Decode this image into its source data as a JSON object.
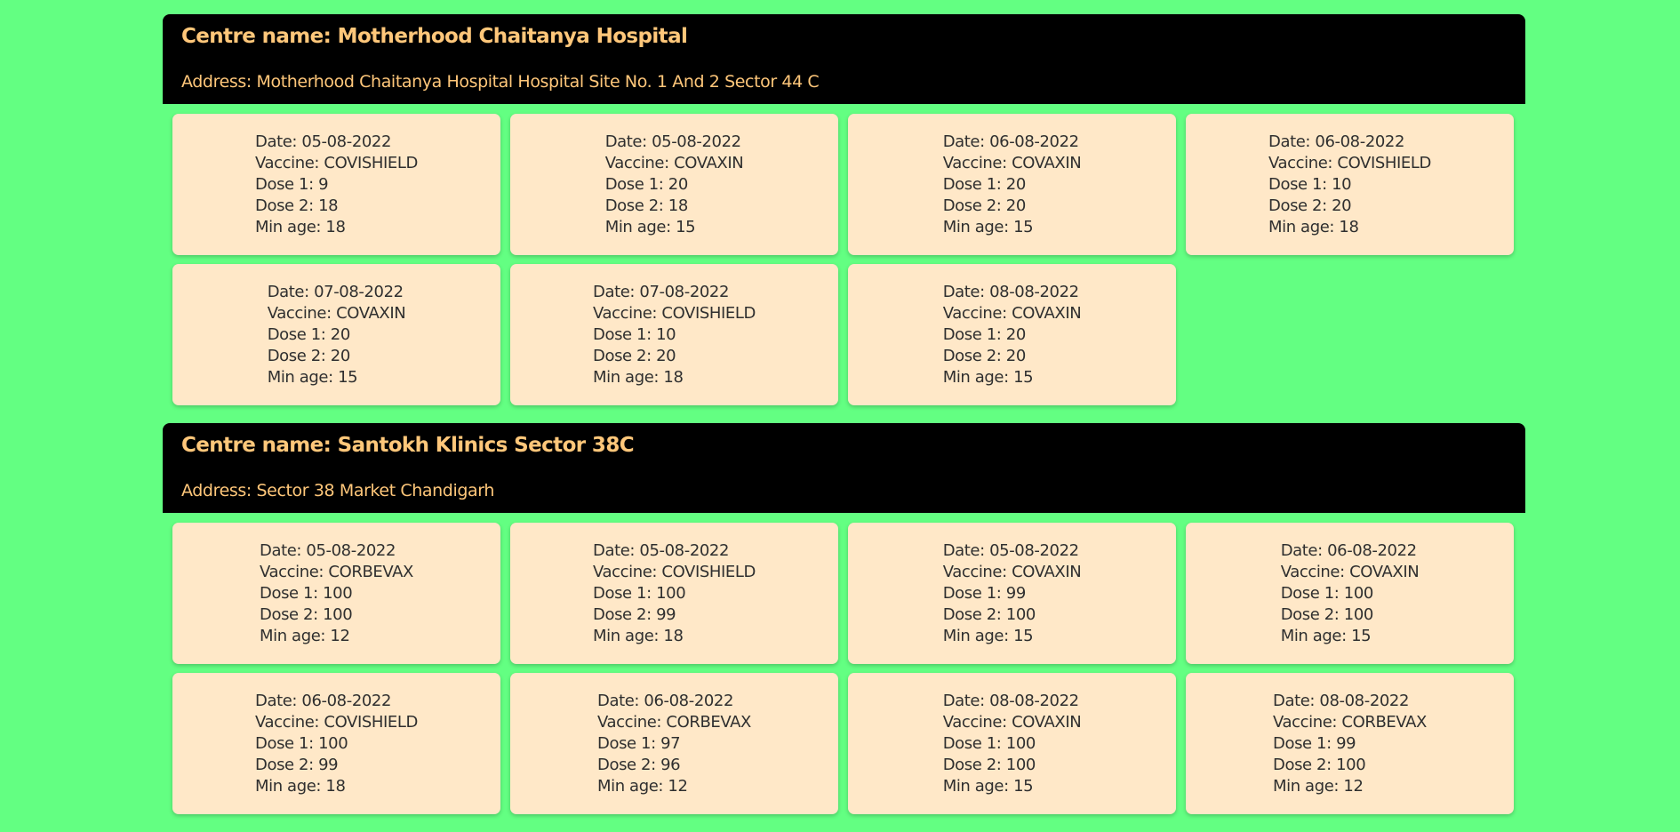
{
  "labels": {
    "centre_prefix": "Centre name: ",
    "address_prefix": "Address: ",
    "date": "Date: ",
    "vaccine": "Vaccine: ",
    "dose1": "Dose 1: ",
    "dose2": "Dose 2: ",
    "min_age": "Min age: "
  },
  "colors": {
    "page_background": "#63ff82",
    "header_background": "#000000",
    "header_text": "#ffc77a",
    "card_background": "#ffe8c8"
  },
  "centres": [
    {
      "name": "Motherhood Chaitanya Hospital",
      "address": "Motherhood Chaitanya Hospital Hospital Site No. 1 And 2 Sector 44 C",
      "sessions": [
        {
          "date": "05-08-2022",
          "vaccine": "COVISHIELD",
          "dose1": "9",
          "dose2": "18",
          "min_age": "18"
        },
        {
          "date": "05-08-2022",
          "vaccine": "COVAXIN",
          "dose1": "20",
          "dose2": "18",
          "min_age": "15"
        },
        {
          "date": "06-08-2022",
          "vaccine": "COVAXIN",
          "dose1": "20",
          "dose2": "20",
          "min_age": "15"
        },
        {
          "date": "06-08-2022",
          "vaccine": "COVISHIELD",
          "dose1": "10",
          "dose2": "20",
          "min_age": "18"
        },
        {
          "date": "07-08-2022",
          "vaccine": "COVAXIN",
          "dose1": "20",
          "dose2": "20",
          "min_age": "15"
        },
        {
          "date": "07-08-2022",
          "vaccine": "COVISHIELD",
          "dose1": "10",
          "dose2": "20",
          "min_age": "18"
        },
        {
          "date": "08-08-2022",
          "vaccine": "COVAXIN",
          "dose1": "20",
          "dose2": "20",
          "min_age": "15"
        }
      ]
    },
    {
      "name": "Santokh Klinics Sector 38C",
      "address": "Sector 38 Market Chandigarh",
      "sessions": [
        {
          "date": "05-08-2022",
          "vaccine": "CORBEVAX",
          "dose1": "100",
          "dose2": "100",
          "min_age": "12"
        },
        {
          "date": "05-08-2022",
          "vaccine": "COVISHIELD",
          "dose1": "100",
          "dose2": "99",
          "min_age": "18"
        },
        {
          "date": "05-08-2022",
          "vaccine": "COVAXIN",
          "dose1": "99",
          "dose2": "100",
          "min_age": "15"
        },
        {
          "date": "06-08-2022",
          "vaccine": "COVAXIN",
          "dose1": "100",
          "dose2": "100",
          "min_age": "15"
        },
        {
          "date": "06-08-2022",
          "vaccine": "COVISHIELD",
          "dose1": "100",
          "dose2": "99",
          "min_age": "18"
        },
        {
          "date": "06-08-2022",
          "vaccine": "CORBEVAX",
          "dose1": "97",
          "dose2": "96",
          "min_age": "12"
        },
        {
          "date": "08-08-2022",
          "vaccine": "COVAXIN",
          "dose1": "100",
          "dose2": "100",
          "min_age": "15"
        },
        {
          "date": "08-08-2022",
          "vaccine": "CORBEVAX",
          "dose1": "99",
          "dose2": "100",
          "min_age": "12"
        }
      ]
    }
  ]
}
